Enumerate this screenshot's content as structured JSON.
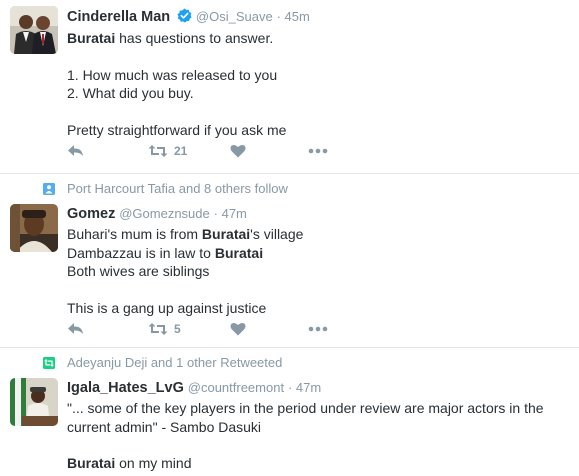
{
  "tweets": [
    {
      "fullname": "Cinderella Man",
      "handle": "@Osi_Suave",
      "time": "· 45m",
      "verified": true,
      "lines": [
        [
          "Buratai",
          " has questions to answer."
        ],
        "",
        "1. How much was released to you",
        "2. What did you buy.",
        "",
        "Pretty straightforward if you ask me"
      ],
      "retweets": "21",
      "likes": ""
    },
    {
      "context": "Port Harcourt Tafia and 8 others follow",
      "fullname": "Gomez",
      "handle": "@Gomeznsude",
      "time": "· 47m",
      "lines": [
        "Buhari's mum is from Buratai's village",
        "Dambazzau is in law to Buratai",
        "Both wives are siblings",
        "",
        "This is a gang up against justice"
      ],
      "retweets": "5",
      "likes": ""
    },
    {
      "context": "Adeyanju Deji and 1 other Retweeted",
      "fullname": "Igala_Hates_LvG",
      "handle": "@countfreemont",
      "time": "· 47m",
      "lines": [
        "\"... some of the key players in the period under review are major actors in the",
        "current admin\" - Sambo Dasuki",
        "",
        "Buratai on my mind"
      ]
    }
  ],
  "colors": {
    "text": "#292f33",
    "muted": "#8899a6",
    "verified": "#1da1f2",
    "follow_icon": "#55acee",
    "retweet_icon": "#19cf86"
  }
}
